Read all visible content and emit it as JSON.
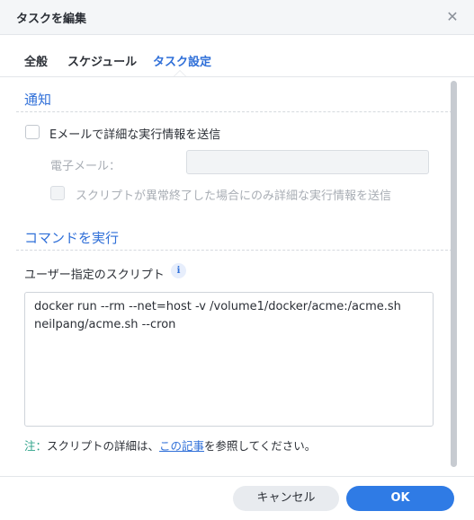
{
  "window": {
    "title": "タスクを編集",
    "close_icon": "close-icon"
  },
  "tabs": [
    {
      "label": "全般",
      "active": false
    },
    {
      "label": "スケジュール",
      "active": false
    },
    {
      "label": "タスク設定",
      "active": true
    }
  ],
  "notify": {
    "section_title": "通知",
    "email_checkbox_label": "Eメールで詳細な実行情報を送信",
    "email_checked": false,
    "email_field_label": "電子メール：",
    "email_field_value": "",
    "abnormal_checkbox_label": "スクリプトが異常終了した場合にのみ詳細な実行情報を送信",
    "abnormal_checked": false
  },
  "command": {
    "section_title": "コマンドを実行",
    "script_label": "ユーザー指定のスクリプト",
    "info_icon": "info-icon",
    "script_value": "docker run --rm --net=host -v /volume1/docker/acme:/acme.sh\nneilpang/acme.sh --cron"
  },
  "note": {
    "prefix": "注：",
    "text_before": "スクリプトの詳細は、",
    "link_text": "この記事",
    "text_after": "を参照してください。"
  },
  "footer": {
    "cancel_label": "キャンセル",
    "ok_label": "OK"
  },
  "colors": {
    "accent": "#2f6fd8",
    "ok_button": "#2f7be5",
    "note_prefix": "#2fa38a"
  }
}
